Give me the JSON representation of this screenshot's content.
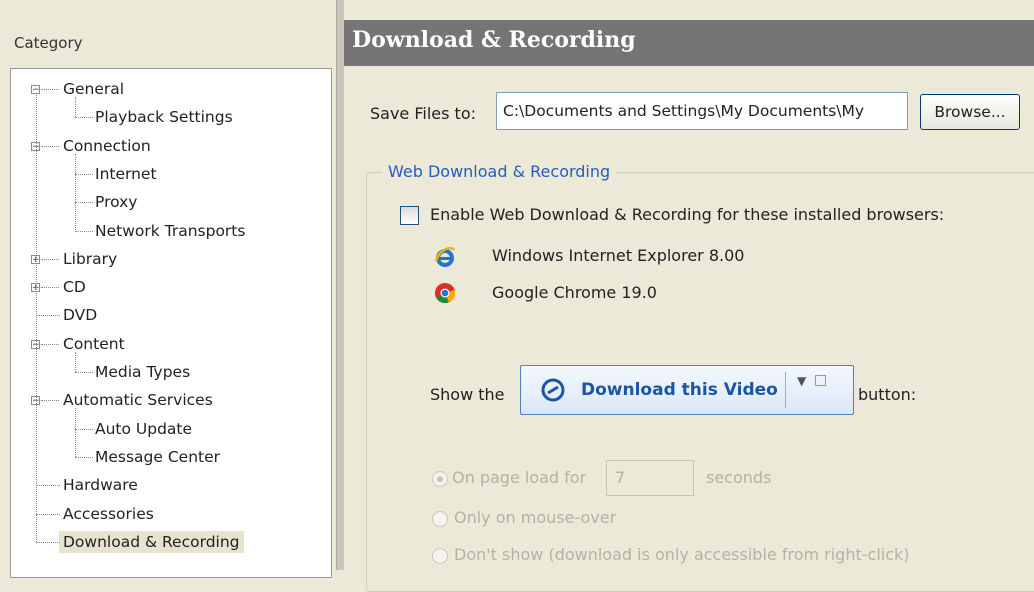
{
  "sidebar": {
    "category_label": "Category",
    "tree": [
      {
        "label": "General",
        "level": 0,
        "expander": "−"
      },
      {
        "label": "Playback Settings",
        "level": 1
      },
      {
        "label": "Connection",
        "level": 0,
        "expander": "−"
      },
      {
        "label": "Internet",
        "level": 1
      },
      {
        "label": "Proxy",
        "level": 1
      },
      {
        "label": "Network Transports",
        "level": 1
      },
      {
        "label": "Library",
        "level": 0,
        "expander": "+"
      },
      {
        "label": "CD",
        "level": 0,
        "expander": "+"
      },
      {
        "label": "DVD",
        "level": 0
      },
      {
        "label": "Content",
        "level": 0,
        "expander": "−"
      },
      {
        "label": "Media Types",
        "level": 1
      },
      {
        "label": "Automatic Services",
        "level": 0,
        "expander": "−"
      },
      {
        "label": "Auto Update",
        "level": 1
      },
      {
        "label": "Message Center",
        "level": 1
      },
      {
        "label": "Hardware",
        "level": 0
      },
      {
        "label": "Accessories",
        "level": 0
      },
      {
        "label": "Download & Recording",
        "level": 0,
        "selected": true
      }
    ]
  },
  "header": {
    "title": "Download & Recording"
  },
  "save": {
    "label": "Save Files to:",
    "path_value": "C:\\Documents and Settings\\My Documents\\My",
    "browse_label": "Browse..."
  },
  "web_group": {
    "title": "Web Download & Recording",
    "enable_label": "Enable Web Download & Recording for these installed browsers:",
    "enable_checked": false,
    "browsers": [
      {
        "name": "Windows Internet Explorer 8.00",
        "icon": "internet-explorer-icon"
      },
      {
        "name": "Google Chrome 19.0",
        "icon": "chrome-icon"
      }
    ],
    "show_prefix": "Show the",
    "download_button_label": "Download this Video",
    "show_suffix": "button:",
    "options": {
      "page_load_label": "On page load for",
      "page_load_seconds": "7",
      "seconds_label": "seconds",
      "mouse_over_label": "Only on mouse-over",
      "dont_show_label": "Don't show (download is only accessible from right-click)"
    }
  },
  "colors": {
    "header_bg": "#757575",
    "group_title": "#245dbd",
    "window_bg": "#ece9d8",
    "disabled_text": "#b4b2a6"
  }
}
